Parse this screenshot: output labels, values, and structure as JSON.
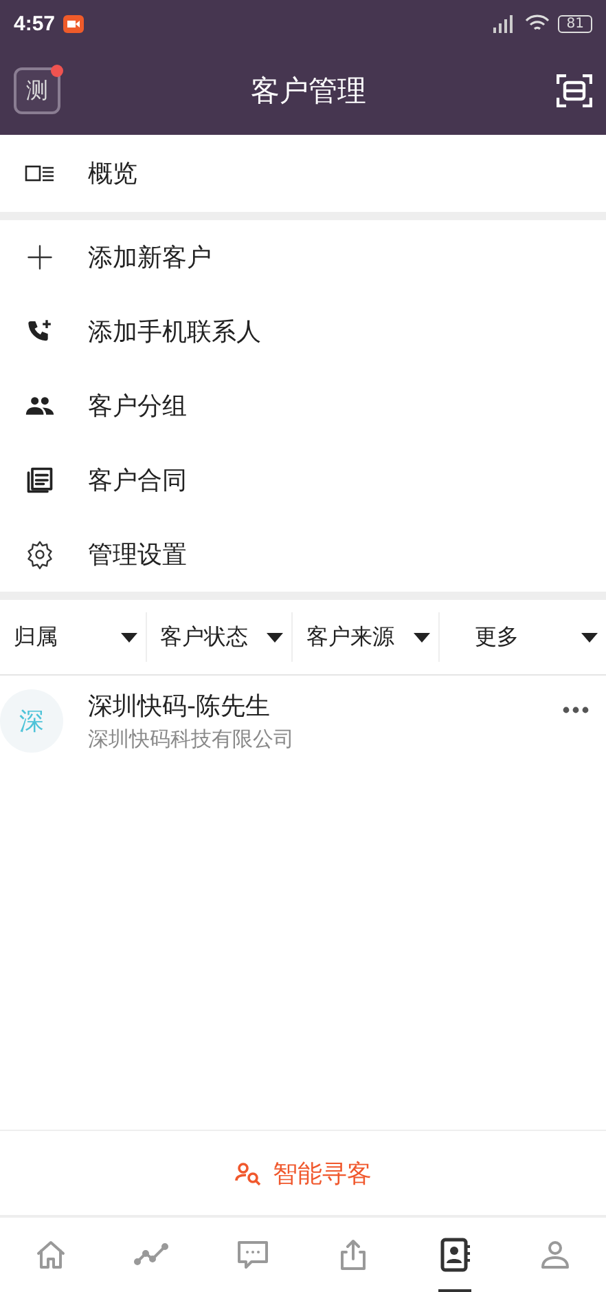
{
  "status_bar": {
    "time": "4:57",
    "battery": "81"
  },
  "header": {
    "avatar": "测",
    "has_notification": true,
    "title": "客户管理"
  },
  "overview": {
    "label": "概览"
  },
  "menu": [
    {
      "kind": "add",
      "label": "添加新客户"
    },
    {
      "kind": "phone",
      "label": "添加手机联系人"
    },
    {
      "kind": "group",
      "label": "客户分组"
    },
    {
      "kind": "contract",
      "label": "客户合同"
    },
    {
      "kind": "settings",
      "label": "管理设置"
    }
  ],
  "filters": [
    {
      "label": "归属"
    },
    {
      "label": "客户状态"
    },
    {
      "label": "客户来源"
    },
    {
      "label": "更多"
    }
  ],
  "customers": [
    {
      "avatar": "深",
      "name": "深圳快码-陈先生",
      "company": "深圳快码科技有限公司"
    }
  ],
  "smart_search": {
    "label": "智能寻客"
  },
  "tab_bar": [
    {
      "kind": "home",
      "selected": false
    },
    {
      "kind": "trend",
      "selected": false
    },
    {
      "kind": "chat",
      "selected": false
    },
    {
      "kind": "share",
      "selected": false
    },
    {
      "kind": "contacts",
      "selected": true
    },
    {
      "kind": "profile",
      "selected": false
    }
  ]
}
